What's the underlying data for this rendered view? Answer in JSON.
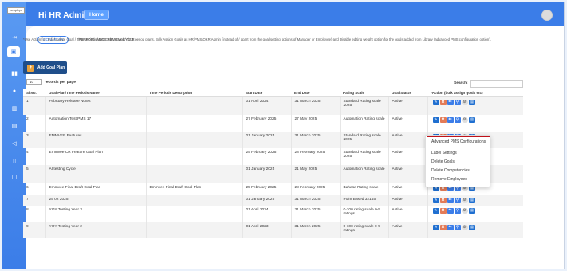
{
  "logo_text": "peoplepr",
  "header": {
    "title": "Hi HR Admin",
    "home_label": "Home"
  },
  "tabs": [
    {
      "label": "GOAL PLAN",
      "active": true
    },
    {
      "label": "PERFORMANCE REVIEW CYCLE",
      "active": false
    }
  ],
  "note": "*Use Action for: Edit/Update Goal / Time period plans, Delete Goal / Time period plans, Bulk Assign Goals as HR/PMS/OKR Admin (instead of / apart from the goal setting options of Manager or Employee) and Disable editing weight option for the goals added from Library (advanced PMS configuration option).",
  "add_button_label": "Add Goal Plan",
  "length": {
    "value": "10",
    "label": "records per page"
  },
  "search_label": "Search:",
  "columns": [
    "Sl.No.",
    "Goal Plan/Time Periods Name",
    "Time Periods Description",
    "Start Date",
    "End Date",
    "Rating Scale",
    "Goal Status",
    "*Action (bulk assign goals etc)"
  ],
  "rows": [
    {
      "no": "1",
      "name": "February Release Notes",
      "desc": "",
      "start": "01 April 2024",
      "end": "31 March 2025",
      "scale": "Standard Rating scale 2025",
      "status": "Active"
    },
    {
      "no": "2",
      "name": "Automation Test PMS 17",
      "desc": "",
      "start": "27 February 2025",
      "end": "27 May 2025",
      "scale": "Automation Rating scale",
      "status": "Active"
    },
    {
      "no": "3",
      "name": "EMMVEE Features",
      "desc": "",
      "start": "01 January 2025",
      "end": "31 March 2025",
      "scale": "Standard Rating scale 2025",
      "status": "Active"
    },
    {
      "no": "4",
      "name": "Emmvee CR Feature Goal Plan",
      "desc": "",
      "start": "25 February 2025",
      "end": "28 February 2025",
      "scale": "Standard Rating scale 2025",
      "status": "Active"
    },
    {
      "no": "5",
      "name": "AI testing Cycle",
      "desc": "",
      "start": "01 January 2025",
      "end": "21 May 2025",
      "scale": "Automation Rating scale",
      "status": "Active"
    },
    {
      "no": "6",
      "name": "Emmvee Final Draft Goal Plan",
      "desc": "Emmvee Final Draft Goal Plan",
      "start": "25 February 2025",
      "end": "28 February 2025",
      "scale": "Bahasa Rating scale",
      "status": "Active"
    },
    {
      "no": "7",
      "name": "25 02 2025",
      "desc": "",
      "start": "01 January 2025",
      "end": "31 March 2025",
      "scale": "Point Based 32145",
      "status": "Active"
    },
    {
      "no": "8",
      "name": "YOY Testing Year 3",
      "desc": "",
      "start": "01 April 2024",
      "end": "31 March 2025",
      "scale": "0-100 rating scale 0-5 ratings",
      "status": "Active"
    },
    {
      "no": "9",
      "name": "YOY Testing Year 2",
      "desc": "",
      "start": "01 April 2023",
      "end": "31 March 2025",
      "scale": "0-100 rating scale 0-5 ratings",
      "status": "Active"
    }
  ],
  "dropdown": {
    "items": [
      "Advanced PMS Configurations",
      "Label Settings",
      "Delete Goals",
      "Delete Competencies",
      "Remove Employees"
    ],
    "highlighted": "Advanced PMS Configurations"
  },
  "colors": {
    "brand": "#3b7de8",
    "highlight_border": "#c0121b"
  }
}
